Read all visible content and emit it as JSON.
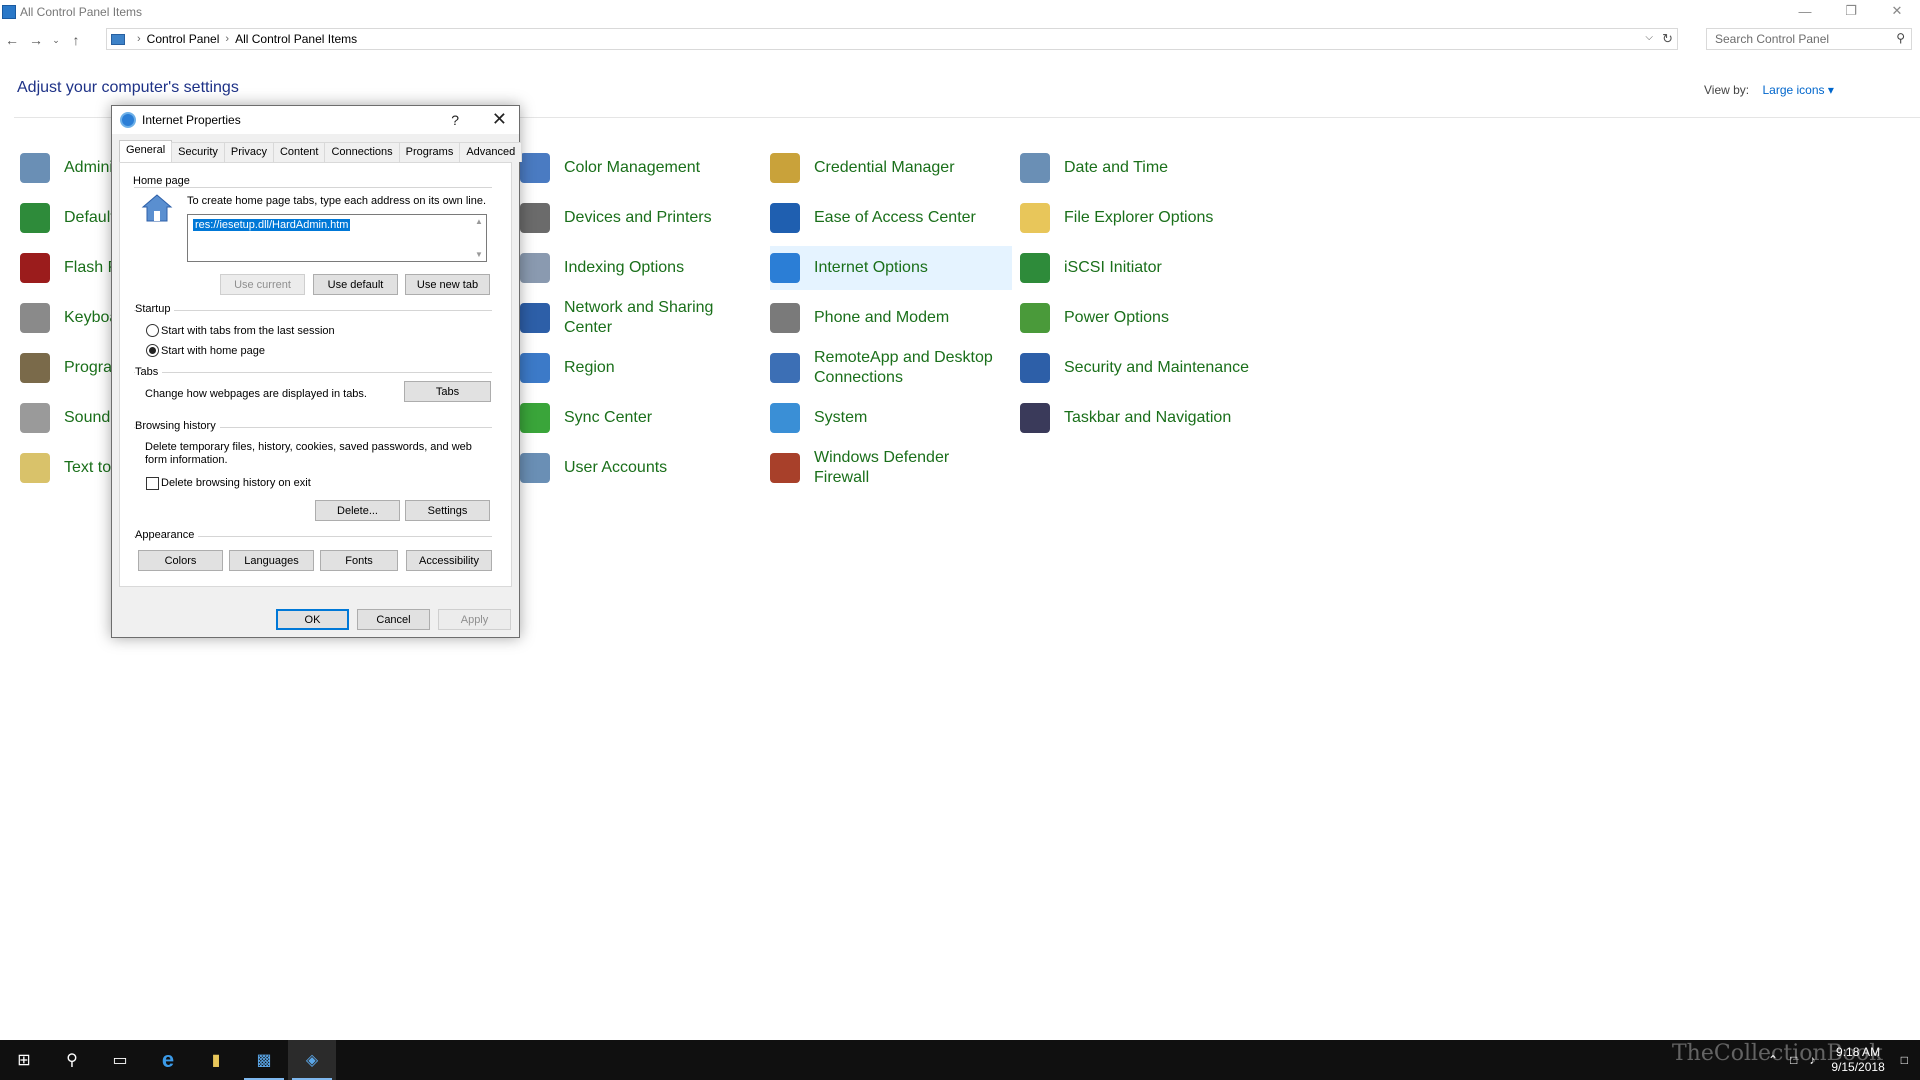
{
  "window": {
    "title": "All Control Panel Items",
    "minimize_glyph": "—",
    "restore_glyph": "❐",
    "close_glyph": "✕"
  },
  "address": {
    "breadcrumbs": [
      "Control Panel",
      "All Control Panel Items"
    ],
    "search_placeholder": "Search Control Panel"
  },
  "header": {
    "title": "Adjust your computer's settings",
    "view_by_label": "View by:",
    "view_by_value": "Large icons"
  },
  "items": [
    {
      "label": "Admini",
      "icon": "administrative-tools-icon",
      "color": "#6a8fb5"
    },
    {
      "label": "Default",
      "icon": "default-programs-icon",
      "color": "#2e8b3a"
    },
    {
      "label": "Flash P",
      "icon": "flash-player-icon",
      "color": "#9b1c1c"
    },
    {
      "label": "Keyboa",
      "icon": "keyboard-icon",
      "color": "#8a8a8a"
    },
    {
      "label": "Progra",
      "icon": "programs-features-icon",
      "color": "#7a6a4a"
    },
    {
      "label": "Sound",
      "icon": "sound-icon",
      "color": "#9a9a9a"
    },
    {
      "label": "Text to",
      "icon": "text-to-speech-icon",
      "color": "#d9c26a"
    },
    {
      "label": "Color Management",
      "icon": "color-management-icon",
      "color": "#4a7bc2"
    },
    {
      "label": "Devices and Printers",
      "icon": "devices-printers-icon",
      "color": "#6b6b6b"
    },
    {
      "label": "Indexing Options",
      "icon": "indexing-options-icon",
      "color": "#8a9ab0"
    },
    {
      "label": "Network and Sharing Center",
      "icon": "network-sharing-icon",
      "color": "#2d5fa8"
    },
    {
      "label": "Region",
      "icon": "region-icon",
      "color": "#3c7ac8"
    },
    {
      "label": "Sync Center",
      "icon": "sync-center-icon",
      "color": "#3aa53a"
    },
    {
      "label": "User Accounts",
      "icon": "user-accounts-icon",
      "color": "#6a8fb5"
    },
    {
      "label": "Credential Manager",
      "icon": "credential-manager-icon",
      "color": "#c9a23a"
    },
    {
      "label": "Ease of Access Center",
      "icon": "ease-of-access-icon",
      "color": "#1f5fb0"
    },
    {
      "label": "Internet Options",
      "icon": "internet-options-icon",
      "color": "#2b7ed6"
    },
    {
      "label": "Phone and Modem",
      "icon": "phone-modem-icon",
      "color": "#7a7a7a"
    },
    {
      "label": "RemoteApp and Desktop Connections",
      "icon": "remoteapp-icon",
      "color": "#3c6fb5"
    },
    {
      "label": "System",
      "icon": "system-icon",
      "color": "#3a8fd6"
    },
    {
      "label": "Windows Defender Firewall",
      "icon": "firewall-icon",
      "color": "#a8402a"
    },
    {
      "label": "Date and Time",
      "icon": "date-time-icon",
      "color": "#6a8fb5"
    },
    {
      "label": "File Explorer Options",
      "icon": "file-explorer-options-icon",
      "color": "#e8c65a"
    },
    {
      "label": "iSCSI Initiator",
      "icon": "iscsi-initiator-icon",
      "color": "#2e8b3a"
    },
    {
      "label": "Power Options",
      "icon": "power-options-icon",
      "color": "#4a9a3a"
    },
    {
      "label": "Security and Maintenance",
      "icon": "security-maintenance-icon",
      "color": "#2d5fa8"
    },
    {
      "label": "Taskbar and Navigation",
      "icon": "taskbar-navigation-icon",
      "color": "#3a3a5a"
    }
  ],
  "dialog": {
    "title": "Internet Properties",
    "help_glyph": "?",
    "close_glyph": "✕",
    "tabs": [
      "General",
      "Security",
      "Privacy",
      "Content",
      "Connections",
      "Programs",
      "Advanced"
    ],
    "home_page": {
      "group": "Home page",
      "instructions": "To create home page tabs, type each address on its own line.",
      "value": "res://iesetup.dll/HardAdmin.htm",
      "use_current": "Use current",
      "use_default": "Use default",
      "use_new_tab": "Use new tab"
    },
    "startup": {
      "group": "Startup",
      "option_last_session": "Start with tabs from the last session",
      "option_home_page": "Start with home page",
      "selected": "home_page"
    },
    "tabs_group": {
      "group": "Tabs",
      "text": "Change how webpages are displayed in tabs.",
      "button": "Tabs"
    },
    "browsing_history": {
      "group": "Browsing history",
      "text": "Delete temporary files, history, cookies, saved passwords, and web form information.",
      "checkbox": "Delete browsing history on exit",
      "checked": false,
      "delete_button": "Delete...",
      "settings_button": "Settings"
    },
    "appearance": {
      "group": "Appearance",
      "colors": "Colors",
      "languages": "Languages",
      "fonts": "Fonts",
      "accessibility": "Accessibility"
    },
    "ok": "OK",
    "cancel": "Cancel",
    "apply": "Apply"
  },
  "taskbar": {
    "time": "9:18 AM",
    "date": "9/15/2018",
    "watermark": "TheCollectionBook"
  }
}
